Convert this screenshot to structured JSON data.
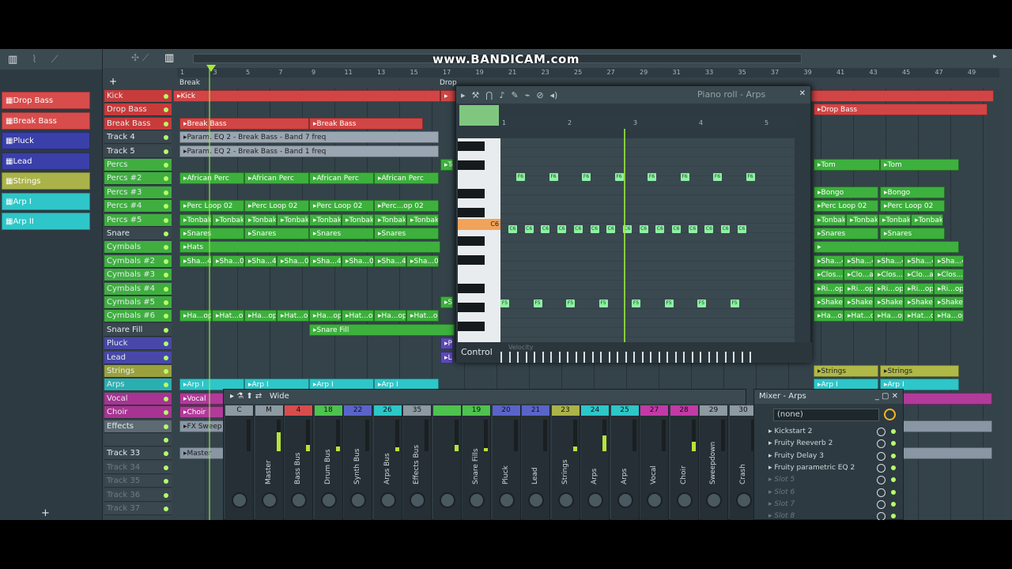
{
  "watermark": "www.BANDICAM.com",
  "browser": {
    "add_label": "+",
    "patterns": [
      {
        "label": "Drop Bass",
        "color": "#d94c4c"
      },
      {
        "label": "Break Bass",
        "color": "#d94c4c"
      },
      {
        "label": "Pluck",
        "color": "#3a3faa"
      },
      {
        "label": "Lead",
        "color": "#3a3faa"
      },
      {
        "label": "Strings",
        "color": "#aab349"
      },
      {
        "label": "Arp I",
        "color": "#2ec6c8"
      },
      {
        "label": "Arp II",
        "color": "#2ec6c8"
      }
    ]
  },
  "ruler": [
    "1",
    "3",
    "5",
    "7",
    "9",
    "11",
    "13",
    "15",
    "17",
    "19",
    "21",
    "23",
    "25",
    "27",
    "29",
    "31",
    "33",
    "35",
    "37",
    "39",
    "41",
    "43",
    "45",
    "47",
    "49"
  ],
  "markers": {
    "break": "Break",
    "drop": "Drop"
  },
  "tracks": [
    "Kick",
    "Drop Bass",
    "Break Bass",
    "Track 4",
    "Track 5",
    "Percs",
    "Percs #2",
    "Percs #3",
    "Percs #4",
    "Percs #5",
    "Snare",
    "Cymbals",
    "Cymbals #2",
    "Cymbals #3",
    "Cymbals #4",
    "Cymbals #5",
    "Cymbals #6",
    "Snare Fill",
    "Pluck",
    "Lead",
    "Strings",
    "Arps",
    "Vocal",
    "Choir",
    "Effects",
    "",
    "Track 33",
    "Track 34",
    "Track 35",
    "Track 36",
    "Track 37"
  ],
  "clips": {
    "kick": "Kick",
    "drop_bass": "Drop Bass",
    "break_bass": "Break Bass",
    "param1": "Param. EQ 2 - Break Bass - Band 7 freq",
    "param2": "Param. EQ 2 - Break Bass - Band 1 freq",
    "african": "African Perc",
    "perc_loop": "Perc Loop 02",
    "perc_loop_short": "Perc...op 02",
    "tonbak": "Tonbak",
    "snares": "Snares",
    "hats": "Hats",
    "shaker": "Sha...4",
    "shaker_04": "Sha...04",
    "hat_loop": "Ha...op",
    "hat_op": "Hat...op",
    "snare_fill": "Snare Fill",
    "fx_sweep": "FX Sweep",
    "vocal": "Vocal",
    "choir": "Choir",
    "arp": "Arp I",
    "master": "Master",
    "tom": "Tom",
    "bongo": "Bongo",
    "strings": "Strings",
    "clo_at": "Clo...at",
    "clos_at": "Clos...at",
    "ri_op": "Ri...op",
    "shaker_full": "Shaker",
    "to": "To",
    "st": "St",
    "pl": "Pl",
    "le": "Le",
    "dr": "Dr"
  },
  "piano_roll": {
    "title": "Piano roll - Arps",
    "key_label": "C6",
    "bar_labels": [
      "1",
      "2",
      "3",
      "4",
      "5"
    ],
    "control_label": "Control",
    "velocity_label": "Velocity",
    "note_f6": "F6",
    "note_c6": "C6",
    "note_f5": "F5"
  },
  "mixer": {
    "preset": "Wide",
    "channels": [
      {
        "num": "C",
        "name": "",
        "color": "#8d9aa2"
      },
      {
        "num": "M",
        "name": "Master",
        "color": "#8d9aa2"
      },
      {
        "num": "4",
        "name": "Bass Bus",
        "color": "#d94c4c"
      },
      {
        "num": "18",
        "name": "Drum Bus",
        "color": "#4ec24e"
      },
      {
        "num": "22",
        "name": "Synth Bus",
        "color": "#5a64c8"
      },
      {
        "num": "26",
        "name": "Arps Bus",
        "color": "#2ec6c8"
      },
      {
        "num": "35",
        "name": "Effects Bus",
        "color": "#8d9aa2"
      },
      {
        "num": "",
        "name": "",
        "color": "#4ec24e"
      },
      {
        "num": "19",
        "name": "Snare Fills",
        "color": "#4ec24e"
      },
      {
        "num": "20",
        "name": "Pluck",
        "color": "#5a64c8"
      },
      {
        "num": "21",
        "name": "Lead",
        "color": "#5a64c8"
      },
      {
        "num": "23",
        "name": "Strings",
        "color": "#aab349"
      },
      {
        "num": "24",
        "name": "Arps",
        "color": "#2ec6c8"
      },
      {
        "num": "25",
        "name": "Arps",
        "color": "#2ec6c8"
      },
      {
        "num": "27",
        "name": "Vocal",
        "color": "#c23aa6"
      },
      {
        "num": "28",
        "name": "Choir",
        "color": "#c23aa6"
      },
      {
        "num": "29",
        "name": "Sweepdown",
        "color": "#8d9aa2"
      },
      {
        "num": "30",
        "name": "Crash",
        "color": "#8d9aa2"
      }
    ]
  },
  "inserts": {
    "title": "Mixer - Arps",
    "preset": "(none)",
    "slots": [
      "Kickstart 2",
      "Fruity Reeverb 2",
      "Fruity Delay 3",
      "Fruity parametric EQ 2",
      "Slot 5",
      "Slot 6",
      "Slot 7",
      "Slot 8"
    ]
  },
  "footer": {
    "add": "+"
  }
}
